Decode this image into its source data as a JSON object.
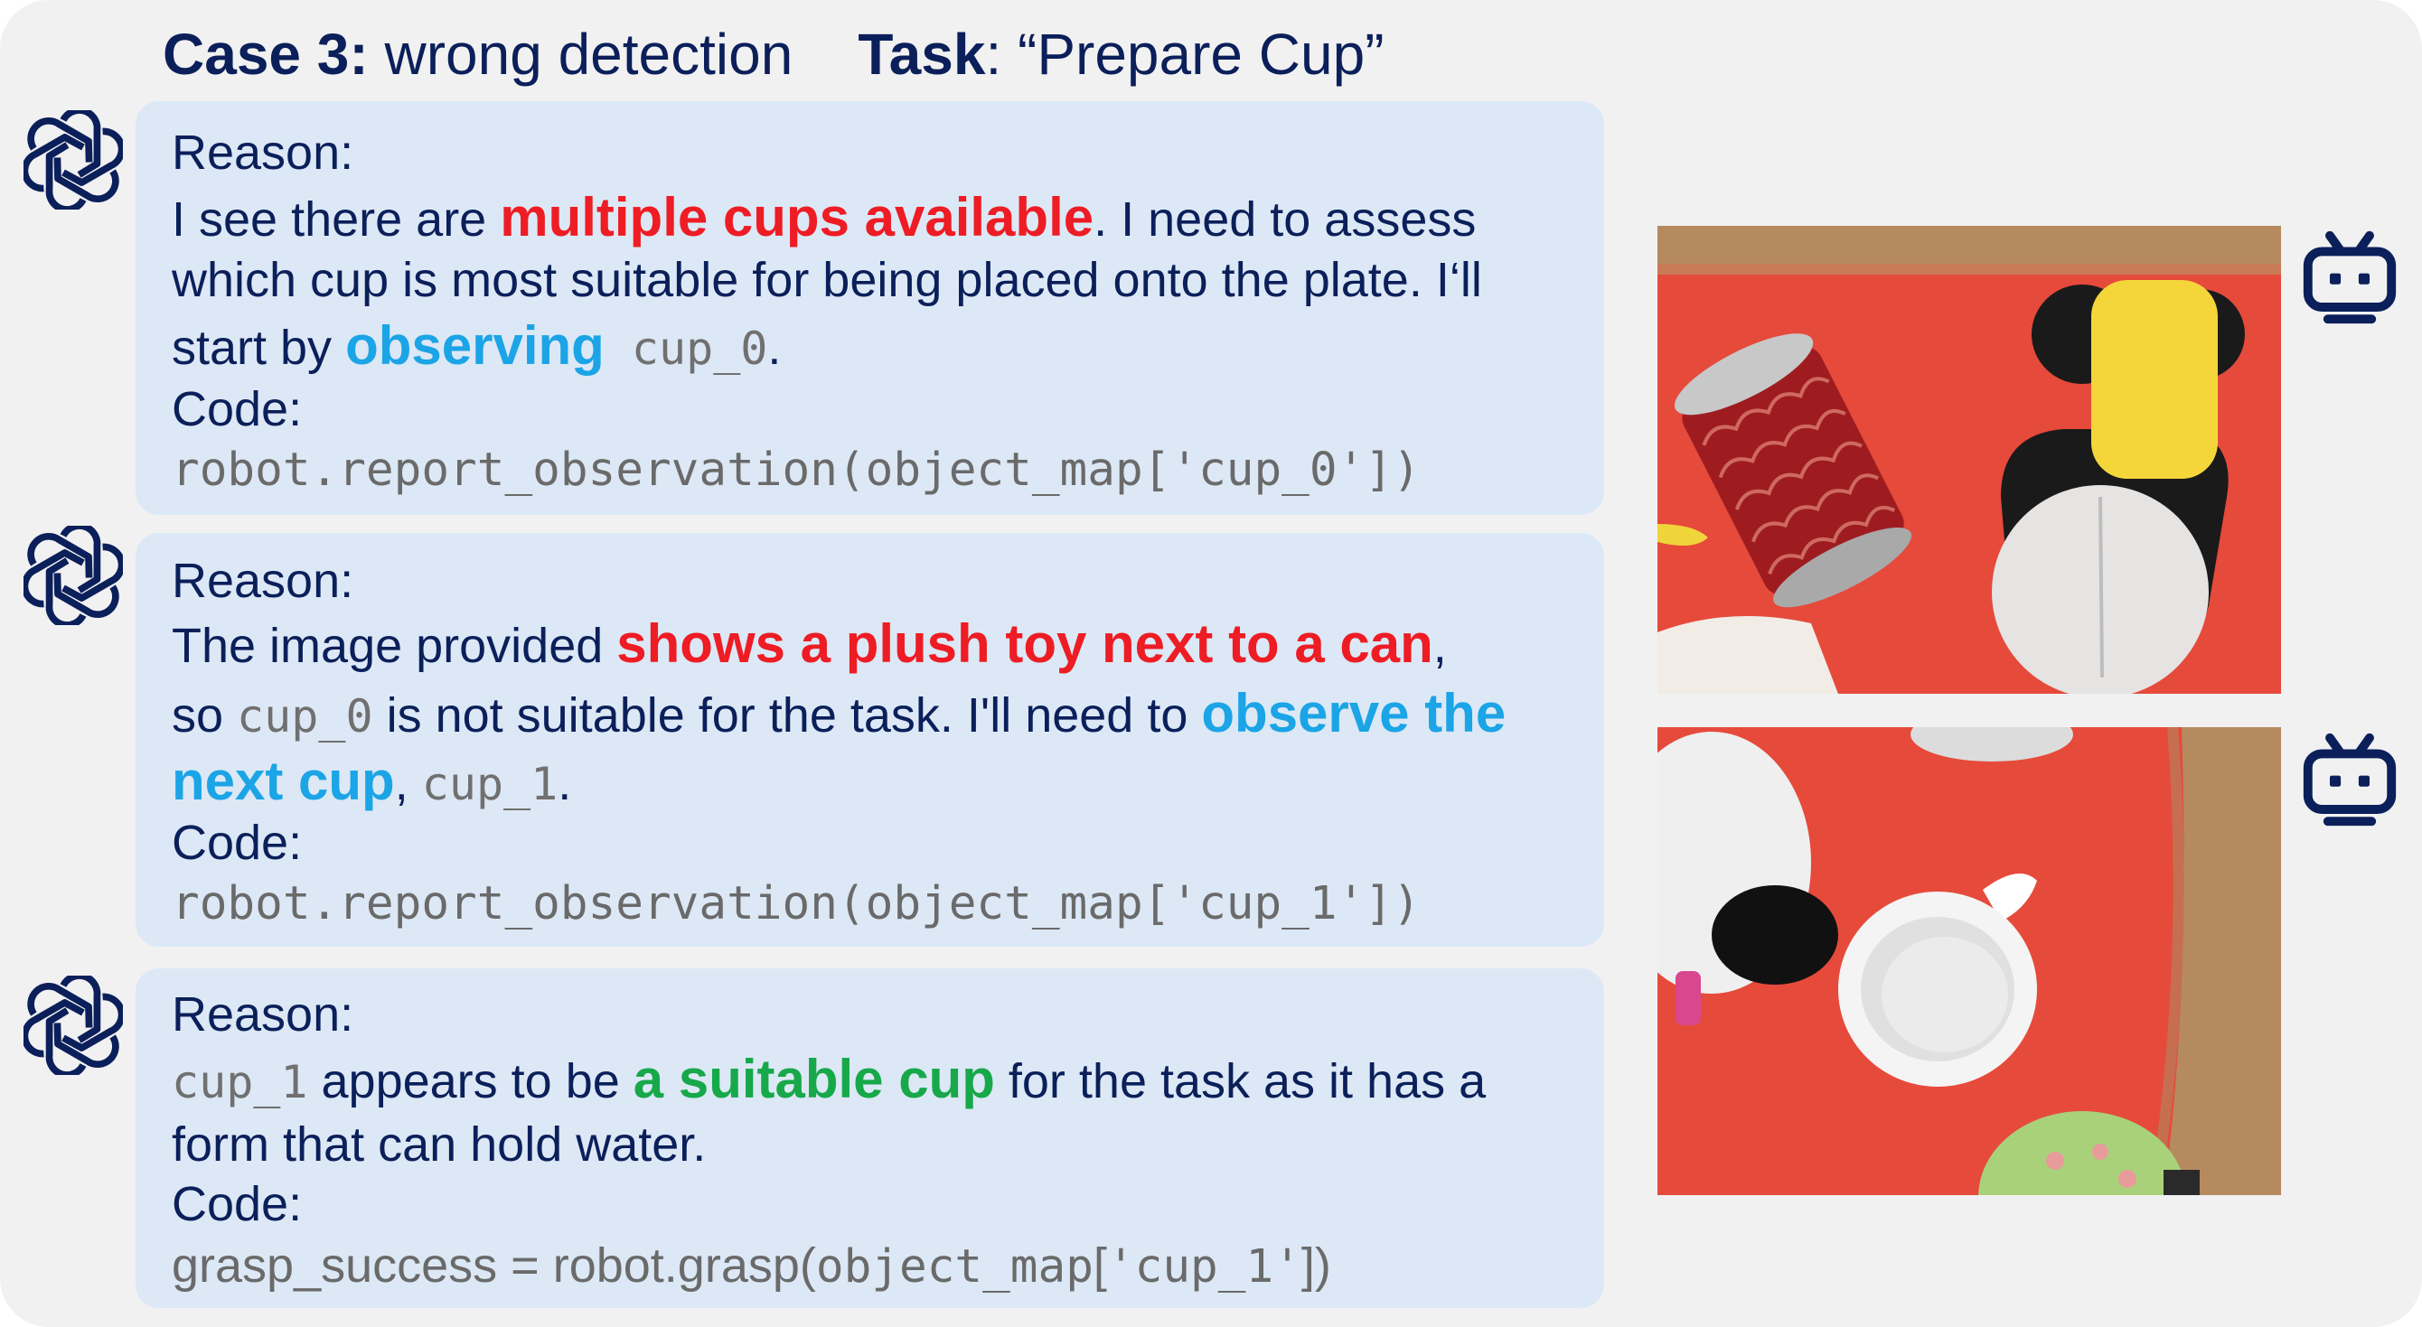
{
  "header": {
    "case_label": "Case 3:",
    "case_text": " wrong detection",
    "task_label": "Task",
    "task_text": ": “Prepare Cup”"
  },
  "steps": [
    {
      "reason_label": "Reason:",
      "l1_pre": "I see there are ",
      "l1_hl": "multiple cups available",
      "l1_post": ". I need to assess",
      "l2": "which cup is most suitable for being placed onto the plate. I‘ll",
      "l3_pre": "start by ",
      "l3_hl": "observing",
      "l3_obj": " cup_0",
      "l3_post": ".",
      "code_label": "Code:",
      "code": "robot.report_observation(object_map['cup_0'])"
    },
    {
      "reason_label": "Reason:",
      "l1_pre": "The image provided ",
      "l1_hl": "shows a plush toy next to a can",
      "l1_post": ",",
      "l2_pre": "so ",
      "l2_obj": "cup_0",
      "l2_mid": " is not suitable for the task. I'll need to ",
      "l2_hl": "observe the",
      "l3_hl": "next cup",
      "l3_mid": ", ",
      "l3_obj": "cup_1",
      "l3_post": ".",
      "code_label": "Code:",
      "code": "robot.report_observation(object_map['cup_1'])"
    },
    {
      "reason_label": "Reason:",
      "l1_obj": "cup_1",
      "l1_pre": " appears to be ",
      "l1_hl": "a suitable cup",
      "l1_post": " for the task as it has a",
      "l2": "form that can hold water.",
      "code_label": "Code:",
      "code_a": "grasp_success = robot.grasp(",
      "code_b": "object_map",
      "code_c": "[",
      "code_d": "'cup_1'",
      "code_e": "])"
    }
  ],
  "icons": {
    "agent": "openai-logo-icon",
    "robot": "robot-head-icon"
  },
  "colors": {
    "navy": "#0b1f5a",
    "red": "#ee1c24",
    "blue": "#1ba4e6",
    "green": "#17a84a",
    "panel": "#dce8f5"
  }
}
